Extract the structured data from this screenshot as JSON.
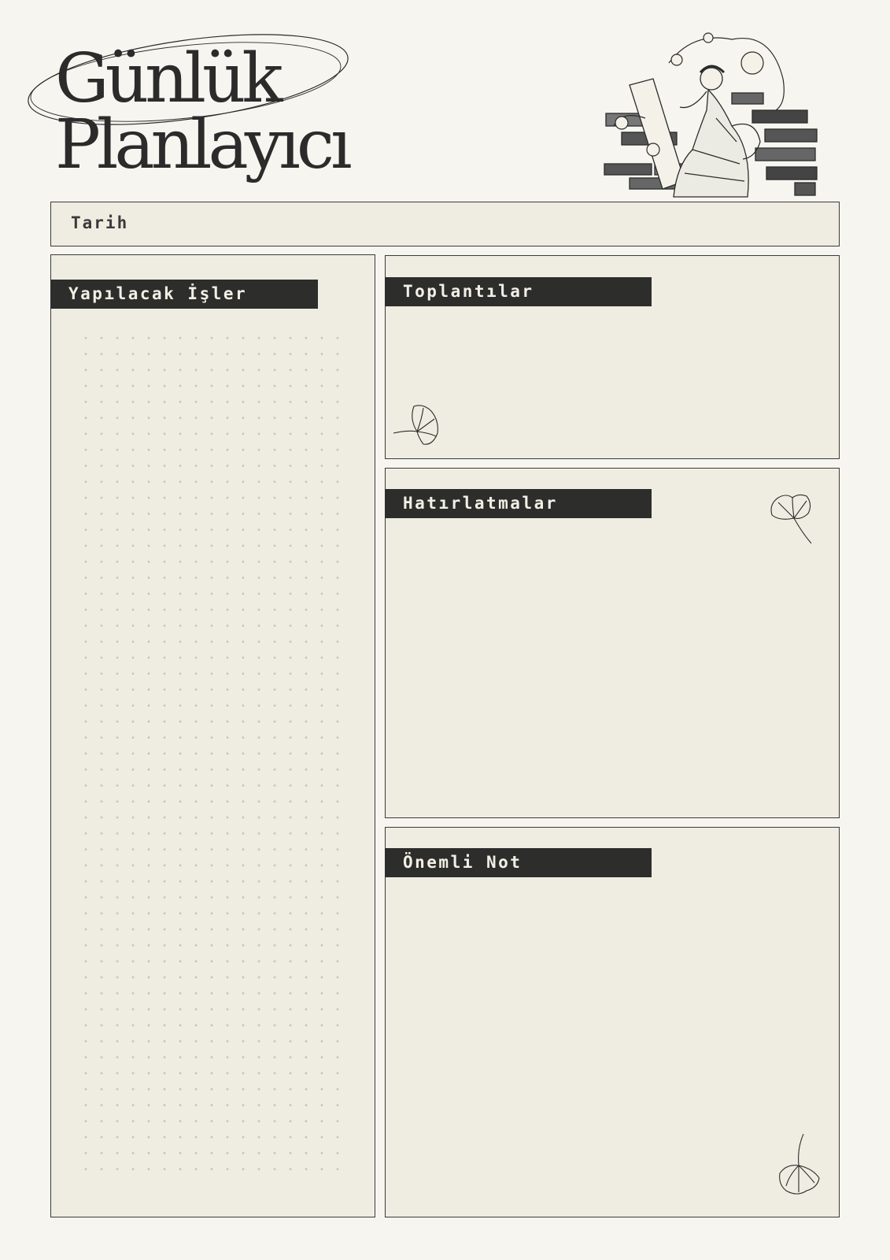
{
  "header": {
    "title_line1": "Günlük",
    "title_line2": "Planlayıcı"
  },
  "date": {
    "label": "Tarih"
  },
  "sections": {
    "todo": "Yapılacak İşler",
    "meetings": "Toplantılar",
    "reminders": "Hatırlatmalar",
    "note": "Önemli Not"
  },
  "icons": {
    "illustration": "classical-woman-drawing-illustration",
    "leaf": "ginkgo-leaf-icon"
  },
  "colors": {
    "page": "#f6f5f0",
    "panel": "#efede2",
    "label_bg": "#2d2d2b",
    "label_text": "#f2f0e6",
    "ink": "#2b2b2b"
  }
}
